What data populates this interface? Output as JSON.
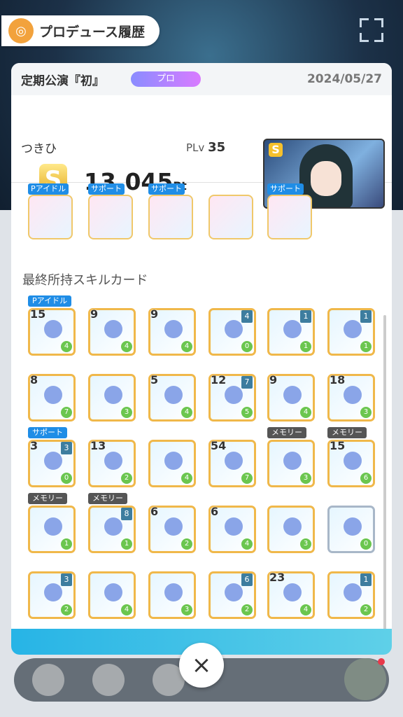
{
  "header": {
    "title": "プロデュース履歴",
    "icon": "produce-icon"
  },
  "record": {
    "title": "定期公演『初』",
    "difficulty": "プロ",
    "date": "2024/05/27",
    "producer_name": "つきひ",
    "plv_label": "PLv",
    "plv_value": "35",
    "rank": "S",
    "score": "13,045",
    "score_unit": "Pt",
    "portrait_rank": "S"
  },
  "items": [
    {
      "tag": "Pアイドル",
      "name": "earphones-item"
    },
    {
      "tag": "サポート",
      "name": "ramen-item"
    },
    {
      "tag": "サポート",
      "name": "towel-item"
    },
    {
      "tag": "",
      "name": "bracelet-item"
    },
    {
      "tag": "サポート",
      "name": "box-item"
    }
  ],
  "skill_section_label": "最終所持スキルカード",
  "skill_cards": [
    {
      "n": "15",
      "c": "",
      "e": "4",
      "tag": "Pアイドル"
    },
    {
      "n": "9",
      "c": "",
      "e": "4",
      "tag": ""
    },
    {
      "n": "9",
      "c": "",
      "e": "4",
      "tag": ""
    },
    {
      "n": "",
      "c": "4",
      "e": "0",
      "tag": ""
    },
    {
      "n": "",
      "c": "1",
      "e": "1",
      "tag": ""
    },
    {
      "n": "",
      "c": "1",
      "e": "1",
      "tag": ""
    },
    {
      "n": "8",
      "c": "",
      "e": "7",
      "tag": ""
    },
    {
      "n": "",
      "c": "",
      "e": "3",
      "tag": ""
    },
    {
      "n": "5",
      "c": "",
      "e": "4",
      "tag": ""
    },
    {
      "n": "12",
      "c": "7",
      "e": "5",
      "tag": ""
    },
    {
      "n": "9",
      "c": "",
      "e": "4",
      "tag": ""
    },
    {
      "n": "18",
      "c": "",
      "e": "3",
      "tag": ""
    },
    {
      "n": "3",
      "c": "3",
      "e": "0",
      "tag": "サポート"
    },
    {
      "n": "13",
      "c": "",
      "e": "2",
      "tag": ""
    },
    {
      "n": "",
      "c": "",
      "e": "4",
      "tag": ""
    },
    {
      "n": "54",
      "c": "",
      "e": "7",
      "tag": ""
    },
    {
      "n": "",
      "c": "",
      "e": "3",
      "tag": "メモリー"
    },
    {
      "n": "15",
      "c": "",
      "e": "6",
      "tag": "メモリー"
    },
    {
      "n": "",
      "c": "",
      "e": "1",
      "tag": "メモリー"
    },
    {
      "n": "",
      "c": "8",
      "e": "1",
      "tag": "メモリー"
    },
    {
      "n": "6",
      "c": "",
      "e": "2",
      "tag": ""
    },
    {
      "n": "6",
      "c": "",
      "e": "4",
      "tag": ""
    },
    {
      "n": "",
      "c": "",
      "e": "3",
      "tag": ""
    },
    {
      "n": "",
      "c": "",
      "e": "0",
      "tag": ""
    },
    {
      "n": "",
      "c": "3",
      "e": "2",
      "tag": ""
    },
    {
      "n": "",
      "c": "",
      "e": "4",
      "tag": ""
    },
    {
      "n": "",
      "c": "",
      "e": "3",
      "tag": ""
    },
    {
      "n": "",
      "c": "6",
      "e": "2",
      "tag": ""
    },
    {
      "n": "23",
      "c": "",
      "e": "4",
      "tag": ""
    },
    {
      "n": "",
      "c": "1",
      "e": "2",
      "tag": ""
    }
  ],
  "nav": {
    "close_label": "×",
    "home": "home-icon",
    "nav2": "calendar-icon",
    "nav3": "back-icon",
    "menu": "menu-icon"
  }
}
